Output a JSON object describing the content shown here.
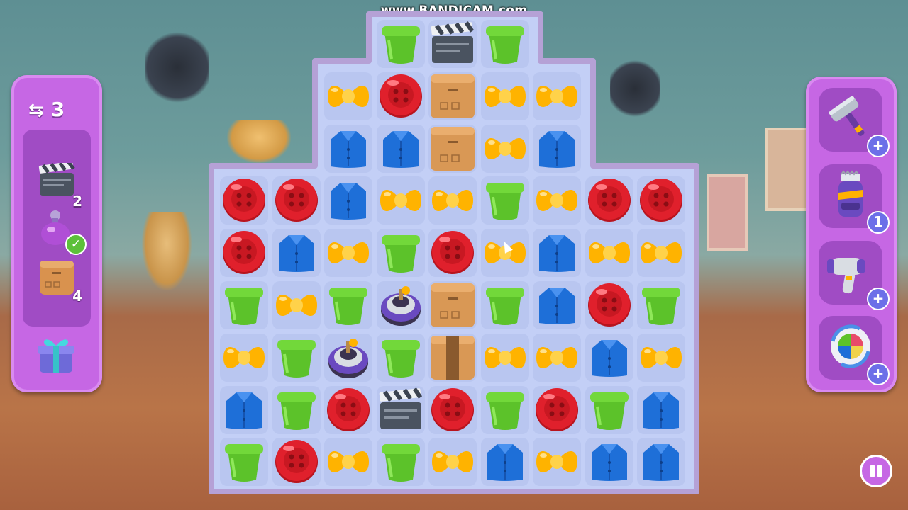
{
  "watermark": "www.BANDICAM.com",
  "hud": {
    "moves_icon": "swap-arrows-icon",
    "moves": "3",
    "goals": [
      {
        "icon": "clapperboard-icon",
        "count": "2",
        "done": false
      },
      {
        "icon": "perfume-bottle-icon",
        "count": "",
        "done": true
      },
      {
        "icon": "cardboard-box-icon",
        "count": "4",
        "done": false
      }
    ],
    "gift_icon": "gift-box-icon"
  },
  "boosters": [
    {
      "icon": "hammer-icon",
      "badge": "+"
    },
    {
      "icon": "hair-clipper-icon",
      "badge": "1"
    },
    {
      "icon": "hair-dryer-icon",
      "badge": "+"
    },
    {
      "icon": "color-shuffle-icon",
      "badge": "+"
    }
  ],
  "colors": {
    "panel": "#c667e4",
    "board_frame": "#b5a1d6",
    "cell": "#b9c6f0",
    "button_red": "#e0202c",
    "bowtie_yellow": "#ffb300",
    "cup_green": "#5cc22a",
    "shirt_blue": "#1e6fd8",
    "box_brown": "#d99855"
  },
  "board": {
    "rows": [
      [
        null,
        null,
        null,
        "G",
        "C",
        "G",
        null,
        null,
        null
      ],
      [
        null,
        null,
        "Y",
        "R",
        "X",
        "Y",
        "Y",
        null,
        null
      ],
      [
        null,
        null,
        "B",
        "B",
        "X",
        "Y",
        "B",
        null,
        null
      ],
      [
        "R",
        "R",
        "B",
        "Y",
        "Y",
        "G",
        "Y",
        "R",
        "R"
      ],
      [
        "R",
        "B",
        "Y",
        "G",
        "R",
        "Y",
        "B",
        "Y",
        "Y"
      ],
      [
        "G",
        "Y",
        "G",
        "T",
        "X",
        "G",
        "B",
        "R",
        "G"
      ],
      [
        "Y",
        "G",
        "T",
        "G",
        "W",
        "Y",
        "Y",
        "B",
        "Y"
      ],
      [
        "B",
        "G",
        "R",
        "C",
        "R",
        "G",
        "R",
        "G",
        "B"
      ],
      [
        "G",
        "R",
        "Y",
        "G",
        "Y",
        "B",
        "Y",
        "B",
        "B"
      ]
    ],
    "legend": {
      "R": "red-button-icon",
      "Y": "yellow-bowtie-icon",
      "G": "green-cup-icon",
      "B": "blue-shirt-icon",
      "X": "cardboard-box-icon",
      "W": "taped-box-icon",
      "C": "clapperboard-icon",
      "T": "spinning-top-bomb-icon"
    }
  },
  "pause_icon": "pause-icon"
}
